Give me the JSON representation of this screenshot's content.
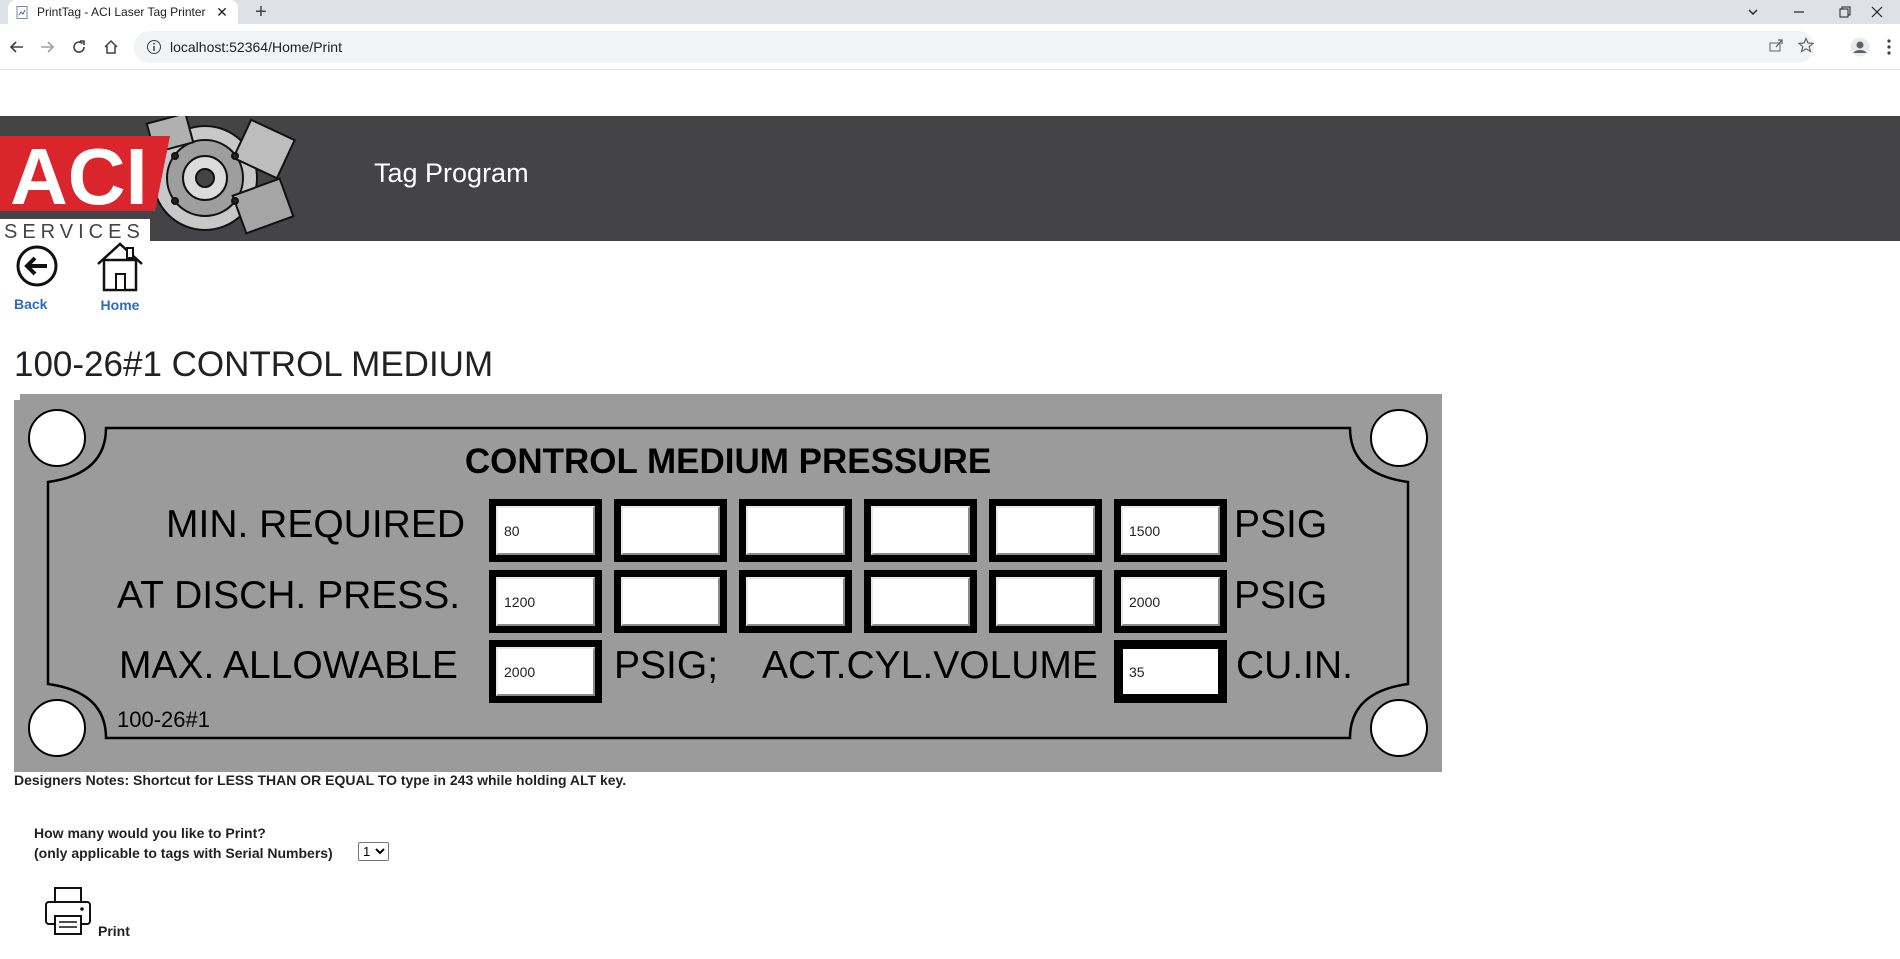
{
  "browser": {
    "tab_title": "PrintTag - ACI Laser Tag Printer",
    "new_tab_symbol": "+",
    "url": "localhost:52364/Home/Print"
  },
  "header": {
    "logo_text": "ACI",
    "logo_subtext": "SERVICES",
    "title": "Tag Program"
  },
  "nav": {
    "back_label": "Back",
    "home_label": "Home"
  },
  "page": {
    "title": "100-26#1 CONTROL MEDIUM"
  },
  "tag": {
    "heading": "CONTROL MEDIUM PRESSURE",
    "row1": {
      "label": "MIN. REQUIRED",
      "values": [
        "80",
        "",
        "",
        "",
        "",
        "1500"
      ],
      "unit": "PSIG"
    },
    "row2": {
      "label": "AT DISCH. PRESS.",
      "values": [
        "1200",
        "",
        "",
        "",
        "",
        "2000"
      ],
      "unit": "PSIG"
    },
    "row3": {
      "label": "MAX. ALLOWABLE",
      "value": "2000",
      "unit_mid": "PSIG;",
      "label_mid": "ACT.CYL.VOLUME",
      "volume": "35",
      "unit": "CU.IN."
    },
    "code": "100-26#1"
  },
  "notes": "Designers Notes: Shortcut for LESS THAN OR EQUAL TO type in 243 while holding ALT key.",
  "print": {
    "question": "How many would you like to Print?",
    "hint": "(only applicable to tags with Serial Numbers)",
    "quantity_options": [
      "1"
    ],
    "quantity_selected": "1",
    "button_label": "Print"
  },
  "colors": {
    "header_bg": "#444446",
    "logo_red": "#d9252b",
    "link_blue": "#2a6ebb",
    "tag_gray": "#9b9b9b"
  }
}
